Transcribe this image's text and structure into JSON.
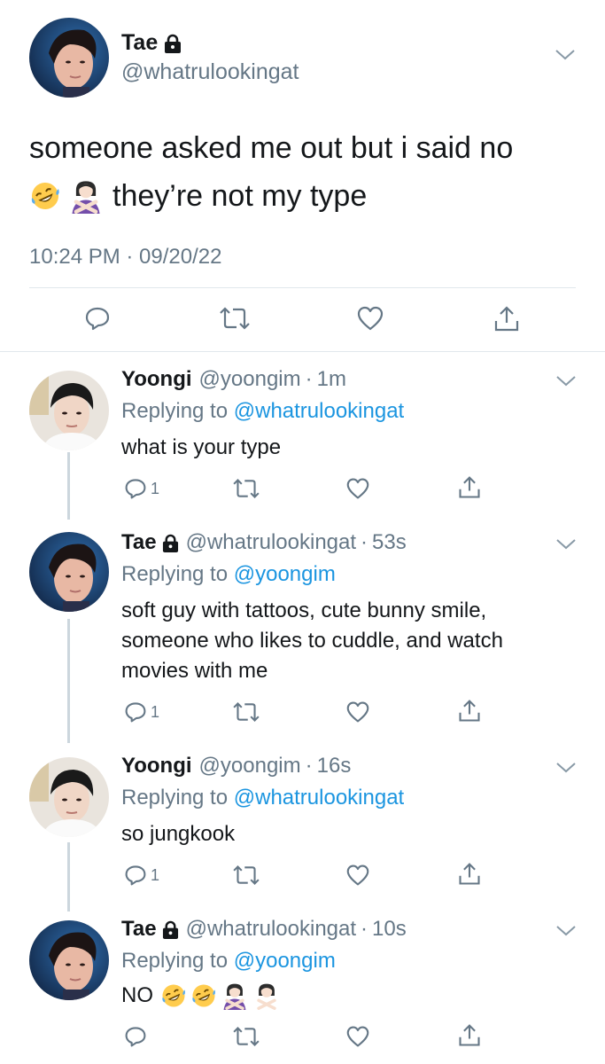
{
  "main_tweet": {
    "display_name": "Tae",
    "handle": "@whatrulookingat",
    "text_line1": "someone asked me out but i said no",
    "text_line2": "they’re not my type",
    "timestamp": "10:24 PM · 09/20/22",
    "icons": [
      "lock-icon",
      "chevron-down-icon",
      "reply-icon",
      "retweet-icon",
      "like-icon",
      "share-icon",
      "rofl-emoji",
      "crossed-arms-emoji"
    ]
  },
  "replies": [
    {
      "display_name": "Yoongi",
      "handle": "@yoongim",
      "dot": "·",
      "time": "1m",
      "replying_prefix": "Replying to",
      "replying_to": "@whatrulookingat",
      "text": "what is your type",
      "reply_count": "1"
    },
    {
      "display_name": "Tae",
      "handle": "@whatrulookingat",
      "dot": "·",
      "time": "53s",
      "replying_prefix": "Replying to",
      "replying_to": "@yoongim",
      "text": "soft guy with tattoos, cute bunny smile, someone who likes to cuddle, and watch movies with me",
      "reply_count": "1"
    },
    {
      "display_name": "Yoongi",
      "handle": "@yoongim",
      "dot": "·",
      "time": "16s",
      "replying_prefix": "Replying to",
      "replying_to": "@whatrulookingat",
      "text": "so jungkook",
      "reply_count": "1"
    },
    {
      "display_name": "Tae",
      "handle": "@whatrulookingat",
      "dot": "·",
      "time": "10s",
      "replying_prefix": "Replying to",
      "replying_to": "@yoongim",
      "text": "NO",
      "reply_count": ""
    }
  ],
  "colors": {
    "text": "#14171a",
    "secondary": "#657786",
    "link": "#1b95e0",
    "thread_line": "#ccd6dd",
    "divider": "#e1e8ed"
  }
}
